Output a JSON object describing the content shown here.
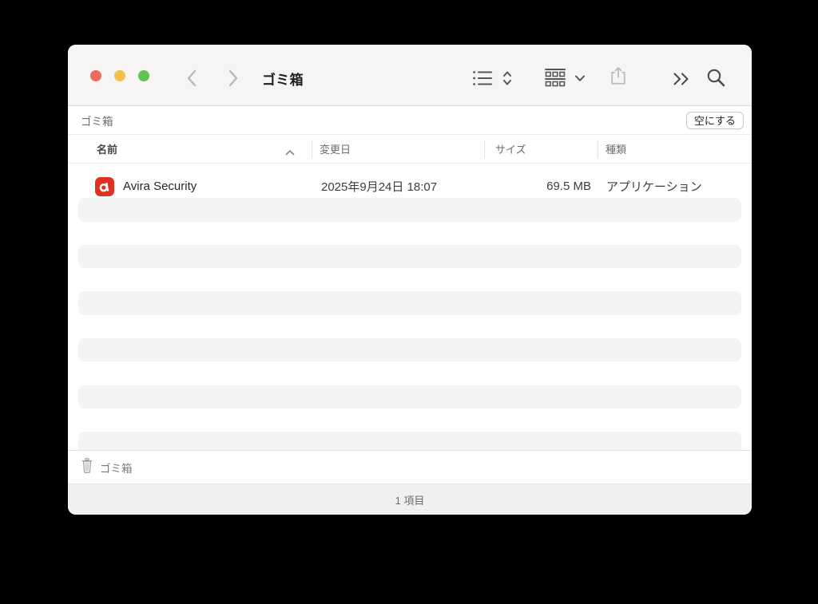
{
  "titlebar": {
    "title": "ゴミ箱"
  },
  "pathbar": {
    "location": "ゴミ箱",
    "empty_button_label": "空にする"
  },
  "table": {
    "columns": [
      {
        "id": "name",
        "label": "名前",
        "sorted": "ascending"
      },
      {
        "id": "date",
        "label": "変更日"
      },
      {
        "id": "size",
        "label": "サイズ"
      },
      {
        "id": "kind",
        "label": "種類"
      }
    ],
    "rows": [
      {
        "icon": "avira-app-icon",
        "name": "Avira Security",
        "date": "2025年9月24日 18:07",
        "size": "69.5 MB",
        "kind": "アプリケーション"
      }
    ]
  },
  "statusbar": {
    "location": "ゴミ箱"
  },
  "footer": {
    "item_count": "1 項目"
  },
  "colors": {
    "traffic_red": "#ed6a5e",
    "traffic_yellow": "#f4bf4f",
    "traffic_green": "#61c354",
    "avira_red": "#e0301f",
    "toolbar_bg": "#f6f5f4",
    "stripe_bg": "#f4f4f3",
    "footer_bg": "#f1f0ef"
  }
}
